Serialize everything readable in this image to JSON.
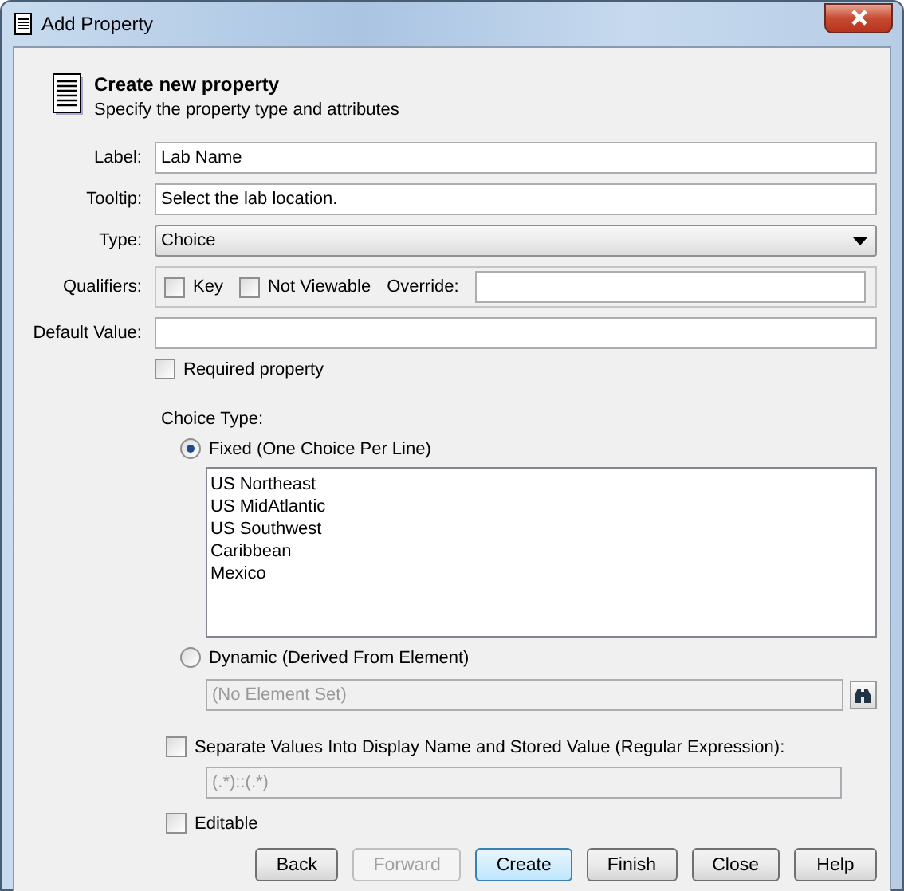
{
  "window": {
    "title": "Add Property"
  },
  "header": {
    "title": "Create new property",
    "subtitle": "Specify the property type and attributes"
  },
  "form": {
    "label": {
      "label": "Label:",
      "value": "Lab Name"
    },
    "tooltip": {
      "label": "Tooltip:",
      "value": "Select the lab location."
    },
    "type": {
      "label": "Type:",
      "value": "Choice"
    },
    "qualifiers": {
      "label": "Qualifiers:",
      "options": [
        {
          "label": "Key",
          "checked": false
        },
        {
          "label": "Not Viewable",
          "checked": false
        }
      ],
      "override": {
        "label": "Override:"
      }
    },
    "default_value": {
      "label": "Default Value:"
    },
    "required": {
      "label": "Required property",
      "checked": false
    }
  },
  "choice_type": {
    "label": "Choice Type:",
    "options": [
      {
        "label": "Fixed (One Choice Per Line)",
        "selected": true
      },
      {
        "label": "Dynamic (Derived From Element)",
        "selected": false
      }
    ],
    "choices": [
      "US Northeast",
      "US MidAtlantic",
      "US Southwest",
      "Caribbean",
      "Mexico"
    ],
    "element": {
      "value": "(No Element Set)",
      "disabled": true
    }
  },
  "separate": {
    "label": "Separate Values Into Display Name and Stored Value (Regular Expression):",
    "checked": false,
    "pattern": {
      "value": "(.*)::(.*)",
      "disabled": true
    }
  },
  "editable": {
    "label": "Editable",
    "checked": false
  },
  "buttons": [
    {
      "label": "Back",
      "disabled": false,
      "default": false
    },
    {
      "label": "Forward",
      "disabled": true,
      "default": false
    },
    {
      "label": "Create",
      "disabled": false,
      "default": true
    },
    {
      "label": "Finish",
      "disabled": false,
      "default": false
    },
    {
      "label": "Close",
      "disabled": false,
      "default": false
    },
    {
      "label": "Help",
      "disabled": false,
      "default": false
    }
  ]
}
